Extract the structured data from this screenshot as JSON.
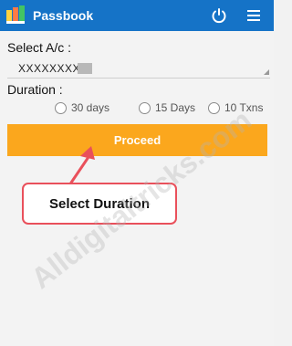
{
  "header": {
    "title": "Passbook",
    "background_color": "#1573c7",
    "icons": [
      "passbook-logo-icon",
      "power-icon",
      "menu-icon"
    ]
  },
  "form": {
    "account_label": "Select A/c :",
    "account_value": "XXXXXXXX",
    "duration_label": "Duration :",
    "duration_options": [
      "30 days",
      "15 Days",
      "10 Txns"
    ],
    "proceed_label": "Proceed",
    "proceed_color": "#fba71d"
  },
  "annotation": {
    "callout_text": "Select  Duration",
    "accent_color": "#e9505b"
  },
  "watermark": "Alldigitaltricks.com"
}
